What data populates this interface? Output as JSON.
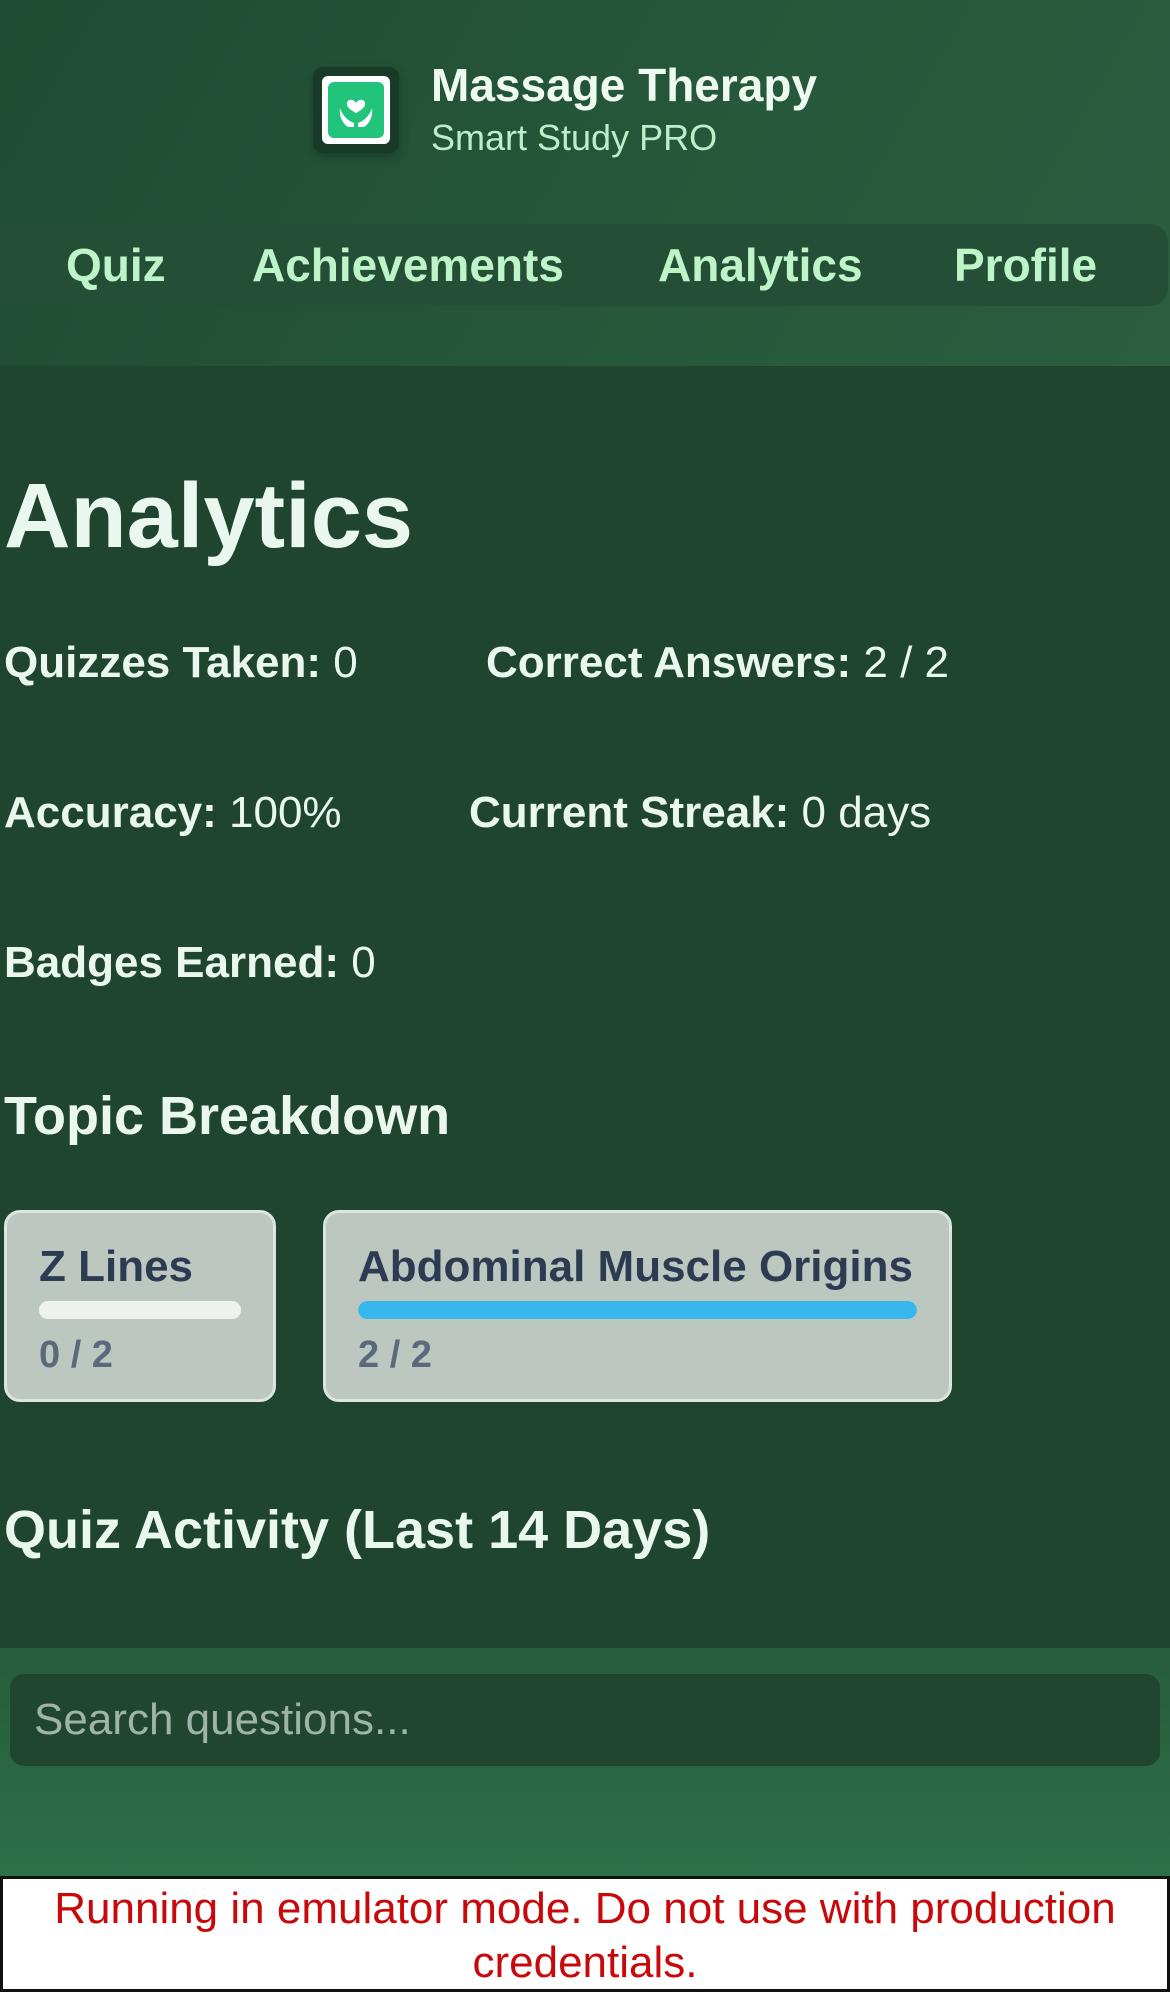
{
  "app": {
    "title": "Massage Therapy",
    "subtitle": "Smart Study PRO",
    "logo_icon": "hands-heart-icon"
  },
  "nav": {
    "items": [
      {
        "label": "Quiz"
      },
      {
        "label": "Achievements"
      },
      {
        "label": "Analytics"
      },
      {
        "label": "Profile"
      }
    ]
  },
  "analytics": {
    "title": "Analytics",
    "stats": {
      "quizzes_taken": {
        "label": "Quizzes Taken:",
        "value": "0"
      },
      "correct_answers": {
        "label": "Correct Answers:",
        "value": "2 / 2"
      },
      "accuracy": {
        "label": "Accuracy:",
        "value": "100%"
      },
      "current_streak": {
        "label": "Current Streak:",
        "value": "0 days"
      },
      "badges_earned": {
        "label": "Badges Earned:",
        "value": "0"
      }
    },
    "topic_breakdown": {
      "title": "Topic Breakdown",
      "topics": [
        {
          "name": "Z Lines",
          "score": "0 / 2",
          "progress": 0
        },
        {
          "name": "Abdominal Muscle Origins",
          "score": "2 / 2",
          "progress": 1
        }
      ]
    },
    "quiz_activity": {
      "title": "Quiz Activity (Last 14 Days)"
    }
  },
  "search": {
    "placeholder": "Search questions..."
  },
  "emulator_banner": {
    "text": "Running in emulator mode. Do not use with production credentials."
  },
  "colors": {
    "accent": "#38b6ee",
    "nav_text": "#bdf5c9",
    "logo_green": "#22c37a",
    "banner_text": "#c8080a"
  }
}
